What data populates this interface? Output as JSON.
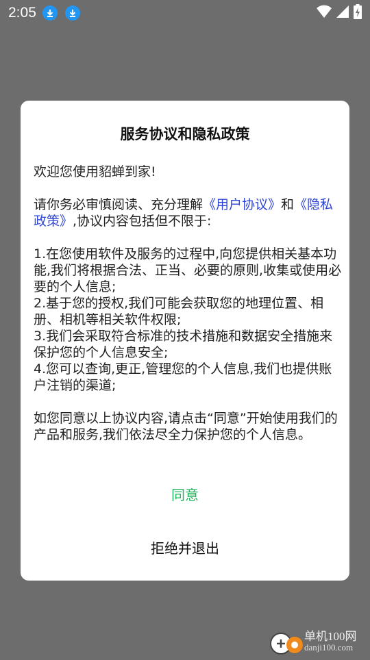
{
  "status_bar": {
    "time": "2:05",
    "icons": [
      "download-icon",
      "download-icon",
      "wifi-icon",
      "signal-icon",
      "battery-charging-icon"
    ]
  },
  "dialog": {
    "title": "服务协议和隐私政策",
    "welcome": "欢迎您使用貂蝉到家!",
    "intro_prefix": "请你务必审慎阅读、充分理解",
    "user_agreement_link": "《用户协议》",
    "intro_and": "和",
    "privacy_policy_link": "《隐私政策》",
    "intro_suffix": ",协议内容包括但不限于:",
    "items": [
      "1.在您使用软件及服务的过程中,向您提供相关基本功能,我们将根据合法、正当、必要的原则,收集或使用必要的个人信息;",
      "2.基于您的授权,我们可能会获取您的地理位置、相册、相机等相关软件权限;",
      "3.我们会采取符合标准的技术措施和数据安全措施来保护您的个人信息安全;",
      "4.您可以查询,更正,管理您的个人信息,我们也提供账户注销的渠道;"
    ],
    "closing": "如您同意以上协议内容,请点击“同意”开始使用我们的产品和服务,我们依法尽全力保护您的个人信息。",
    "agree_label": "同意",
    "reject_label": "拒绝并退出"
  },
  "colors": {
    "link": "#2f46d6",
    "agree": "#22b35e",
    "overlay": "#6d6d6d"
  },
  "watermark": {
    "main": "单机100网",
    "sub": "danji100.com"
  }
}
